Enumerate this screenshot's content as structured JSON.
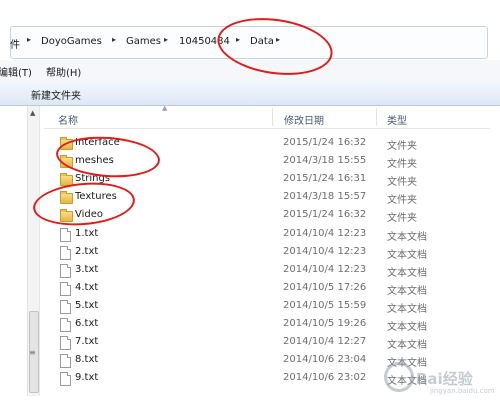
{
  "breadcrumb": {
    "items": [
      "件",
      "DoyoGames",
      "Games",
      "10450484",
      "Data"
    ],
    "separator": "▸"
  },
  "menu": {
    "items": [
      "编辑(T)",
      "帮助(H)"
    ]
  },
  "toolbar": {
    "new_folder": "新建文件夹"
  },
  "columns": {
    "name": "名称",
    "date": "修改日期",
    "type": "类型"
  },
  "files": [
    {
      "name": "Interface",
      "date": "2015/1/24 16:32",
      "type": "文件夹",
      "kind": "folder"
    },
    {
      "name": "meshes",
      "date": "2014/3/18 15:55",
      "type": "文件夹",
      "kind": "folder"
    },
    {
      "name": "Strings",
      "date": "2015/1/24 16:31",
      "type": "文件夹",
      "kind": "folder"
    },
    {
      "name": "Textures",
      "date": "2014/3/18 15:57",
      "type": "文件夹",
      "kind": "folder"
    },
    {
      "name": "Video",
      "date": "2015/1/24 16:32",
      "type": "文件夹",
      "kind": "folder"
    },
    {
      "name": "1.txt",
      "date": "2014/10/4 12:23",
      "type": "文本文档",
      "kind": "txt"
    },
    {
      "name": "2.txt",
      "date": "2014/10/4 12:23",
      "type": "文本文档",
      "kind": "txt"
    },
    {
      "name": "3.txt",
      "date": "2014/10/4 12:23",
      "type": "文本文档",
      "kind": "txt"
    },
    {
      "name": "4.txt",
      "date": "2014/10/5 17:26",
      "type": "文本文档",
      "kind": "txt"
    },
    {
      "name": "5.txt",
      "date": "2014/10/5 15:59",
      "type": "文本文档",
      "kind": "txt"
    },
    {
      "name": "6.txt",
      "date": "2014/10/5 19:26",
      "type": "文本文档",
      "kind": "txt"
    },
    {
      "name": "7.txt",
      "date": "2014/10/4 12:27",
      "type": "文本文档",
      "kind": "txt"
    },
    {
      "name": "8.txt",
      "date": "2014/10/6 23:04",
      "type": "文本文档",
      "kind": "txt"
    },
    {
      "name": "9.txt",
      "date": "2014/10/6 23:02",
      "type": "文本文档",
      "kind": "txt"
    }
  ],
  "annotation_color": "#e01b1b",
  "watermark": {
    "icon": "baidu-logo-icon",
    "text": "Bai经验",
    "sub": "jingyan.baidu.com"
  }
}
